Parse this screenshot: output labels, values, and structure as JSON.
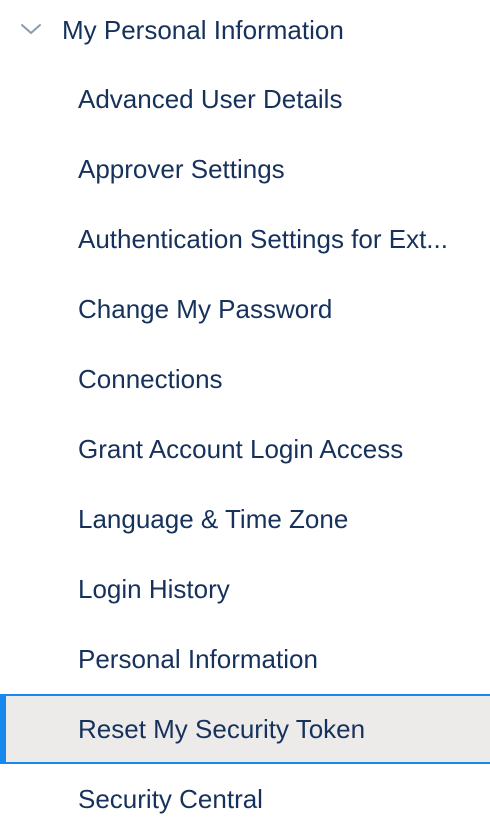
{
  "section": {
    "title": "My Personal Information",
    "expanded": true,
    "chevron_icon": "chevron-down-icon"
  },
  "items": [
    {
      "label": "Advanced User Details",
      "name": "advanced-user-details"
    },
    {
      "label": "Approver Settings",
      "name": "approver-settings"
    },
    {
      "label": "Authentication Settings for Ext...",
      "name": "authentication-settings"
    },
    {
      "label": "Change My Password",
      "name": "change-my-password"
    },
    {
      "label": "Connections",
      "name": "connections"
    },
    {
      "label": "Grant Account Login Access",
      "name": "grant-account-login-access"
    },
    {
      "label": "Language & Time Zone",
      "name": "language-time-zone"
    },
    {
      "label": "Login History",
      "name": "login-history"
    },
    {
      "label": "Personal Information",
      "name": "personal-information"
    },
    {
      "label": "Reset My Security Token",
      "name": "reset-my-security-token",
      "selected": true
    },
    {
      "label": "Security Central",
      "name": "security-central"
    }
  ],
  "colors": {
    "text": "#16325c",
    "selected_background": "#ecebea",
    "selected_border": "#1589ee",
    "chevron": "#8a9bb0"
  }
}
